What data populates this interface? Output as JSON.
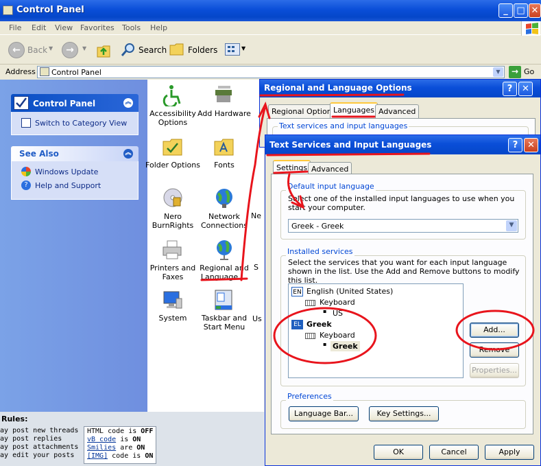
{
  "explorer": {
    "title": "Control Panel",
    "menu": [
      "File",
      "Edit",
      "View",
      "Favorites",
      "Tools",
      "Help"
    ],
    "toolbar": {
      "back": "Back",
      "search": "Search",
      "folders": "Folders"
    },
    "address_label": "Address",
    "address_value": "Control Panel",
    "go_label": "Go"
  },
  "left_pane": {
    "control_panel": {
      "header": "Control Panel",
      "link": "Switch to Category View"
    },
    "see_also": {
      "header": "See Also",
      "links": [
        "Windows Update",
        "Help and Support"
      ]
    }
  },
  "icons": [
    {
      "label": "Accessibility Options",
      "icon": "accessibility-icon"
    },
    {
      "label": "Add Hardware",
      "icon": "add-hardware-icon"
    },
    {
      "label": "Folder Options",
      "icon": "folder-options-icon"
    },
    {
      "label": "Fonts",
      "icon": "fonts-icon"
    },
    {
      "label": "Nero BurnRights",
      "icon": "nero-burnrights-icon"
    },
    {
      "label": "Network Connections",
      "icon": "network-connections-icon"
    },
    {
      "label": "Printers and Faxes",
      "icon": "printers-icon"
    },
    {
      "label": "Regional and Language ...",
      "icon": "regional-language-icon"
    },
    {
      "label": "System",
      "icon": "system-icon"
    },
    {
      "label": "Taskbar and Start Menu",
      "icon": "taskbar-icon"
    }
  ],
  "icons_cut": [
    "Ne",
    "S",
    "Us"
  ],
  "forum_rules": {
    "title": "Rules:",
    "left": [
      "may post new threads",
      "may post replies",
      "may post attachments",
      "may edit your posts"
    ],
    "right": [
      {
        "pre": "",
        "link": "",
        "text": "HTML code is",
        "state": "OFF"
      },
      {
        "pre": "",
        "link": "vB code",
        "text": "is",
        "state": "ON"
      },
      {
        "pre": "",
        "link": "Smilies",
        "text": "are",
        "state": "ON"
      },
      {
        "pre": "",
        "link": "[IMG]",
        "text": "code is",
        "state": "ON"
      }
    ]
  },
  "rlo_dialog": {
    "title": "Regional and Language Options",
    "tabs": [
      "Regional Options",
      "Languages",
      "Advanced"
    ],
    "active_tab": "Languages",
    "group_label": "Text services and input languages"
  },
  "tsil_dialog": {
    "title": "Text Services and Input Languages",
    "tabs": [
      "Settings",
      "Advanced"
    ],
    "active_tab": "Settings",
    "default_lang": {
      "group": "Default input language",
      "desc": "Select one of the installed input languages to use when you start your computer.",
      "value": "Greek - Greek"
    },
    "installed": {
      "group": "Installed services",
      "desc": "Select the services that you want for each input language shown in the list. Use the Add and Remove buttons to modify this list.",
      "tree": [
        {
          "badge": "EN",
          "lang": "English (United States)",
          "kb_label": "Keyboard",
          "layout": "US"
        },
        {
          "badge": "EL",
          "lang": "Greek",
          "kb_label": "Keyboard",
          "layout": "Greek"
        }
      ],
      "buttons": {
        "add": "Add...",
        "remove": "Remove",
        "properties": "Properties..."
      }
    },
    "preferences": {
      "group": "Preferences",
      "language_bar": "Language Bar...",
      "key_settings": "Key Settings..."
    },
    "footer": {
      "ok": "OK",
      "cancel": "Cancel",
      "apply": "Apply"
    },
    "help": "?",
    "close": "✕"
  },
  "colors": {
    "xp_blue": "#0a4ed8",
    "annotation_red": "#e8141c",
    "link_blue": "#0c2a86"
  }
}
